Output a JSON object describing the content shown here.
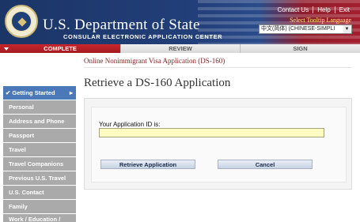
{
  "header": {
    "brand": "U.S. Department of State",
    "tagline": "CONSULAR ELECTRONIC APPLICATION CENTER",
    "links": [
      "Contact Us",
      "Help",
      "Exit"
    ],
    "tooltip_language_label": "Select Tooltip Language",
    "language_selected": "中文(简体) (CHINESE-SIMPLI"
  },
  "progress": {
    "steps": [
      {
        "label": "COMPLETE",
        "active": true
      },
      {
        "label": "REVIEW",
        "active": false
      },
      {
        "label": "SIGN",
        "active": false
      }
    ]
  },
  "app_subtitle": "Online Nonimmigrant Visa Application (DS-160)",
  "sidebar": {
    "items": [
      {
        "label": "Getting Started",
        "active": true
      },
      {
        "label": "Personal"
      },
      {
        "label": "Address and Phone"
      },
      {
        "label": "Passport"
      },
      {
        "label": "Travel"
      },
      {
        "label": "Travel Companions"
      },
      {
        "label": "Previous U.S. Travel"
      },
      {
        "label": "U.S. Contact"
      },
      {
        "label": "Family"
      },
      {
        "label": "Work / Education / Training"
      }
    ]
  },
  "main": {
    "title": "Retrieve a DS-160 Application",
    "field_label": "Your Application ID is:",
    "field_value": "",
    "retrieve_label": "Retrieve Application",
    "cancel_label": "Cancel"
  },
  "colors": {
    "header_blue": "#1b3566",
    "header_red": "#a31f2f",
    "complete_red": "#c8272c",
    "sidebar_active": "#4a78b8",
    "sidebar_gray": "#aaaaaa",
    "input_yellow": "#fffcc2"
  }
}
